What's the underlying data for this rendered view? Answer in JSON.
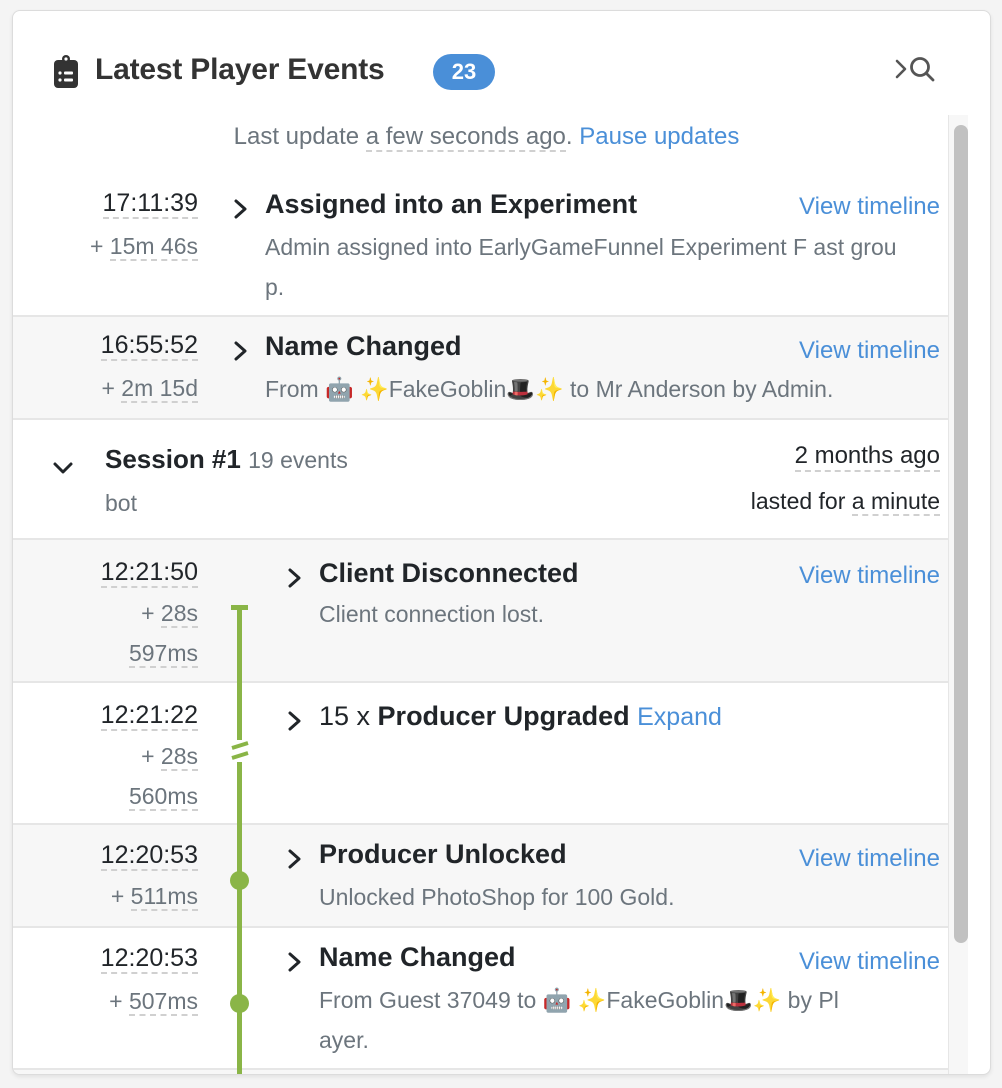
{
  "header": {
    "title": "Latest Player Events",
    "count_badge": "23",
    "icon": "clipboard-list-icon",
    "search_toggle_icon": "chevron-search-icon"
  },
  "status": {
    "prefix": "Last update ",
    "ago": "a few seconds ago",
    "suffix": ". ",
    "pause_link": "Pause updates"
  },
  "events_top": [
    {
      "time": "17:11:39",
      "delta_prefix": "+ ",
      "delta": "15m 46s",
      "title": "Assigned into an Experiment",
      "desc": "Admin assigned into EarlyGameFunnel Experiment F ast group.",
      "link": "View timeline"
    },
    {
      "time": "16:55:52",
      "delta_prefix": "+ ",
      "delta": "2m 15d",
      "title": "Name Changed",
      "desc": "From 🤖 ✨FakeGoblin🎩✨ to Mr Anderson by Admin.",
      "link": "View timeline"
    }
  ],
  "session": {
    "title": "Session #1",
    "events_count": "19 events",
    "subtitle": "bot",
    "ago": "2 months ago",
    "lasted_prefix": "lasted for ",
    "lasted": "a minute"
  },
  "session_events": [
    {
      "time": "12:21:50",
      "delta_prefix": "+ ",
      "delta": "28s",
      "delta2": "597ms",
      "title": "Client Disconnected",
      "desc": "Client connection lost.",
      "link": "View timeline"
    },
    {
      "time": "12:21:22",
      "delta_prefix": "+ ",
      "delta": "28s",
      "delta2": "560ms",
      "count_prefix": "15 x ",
      "title": "Producer Upgraded",
      "expand_link": "Expand"
    },
    {
      "time": "12:20:53",
      "delta_prefix": "+ ",
      "delta": "511ms",
      "title": "Producer Unlocked",
      "desc": "Unlocked PhotoShop for 100 Gold.",
      "link": "View timeline"
    },
    {
      "time": "12:20:53",
      "delta_prefix": "+ ",
      "delta": "507ms",
      "title": "Name Changed",
      "desc_line1": "From Guest 37049 to 🤖 ✨FakeGoblin🎩✨ by Pl",
      "desc_line2": "ayer.",
      "link": "View timeline"
    }
  ],
  "colors": {
    "accent": "#4a8fd8",
    "timeline": "#8ab547",
    "muted_text": "#6c757d"
  }
}
